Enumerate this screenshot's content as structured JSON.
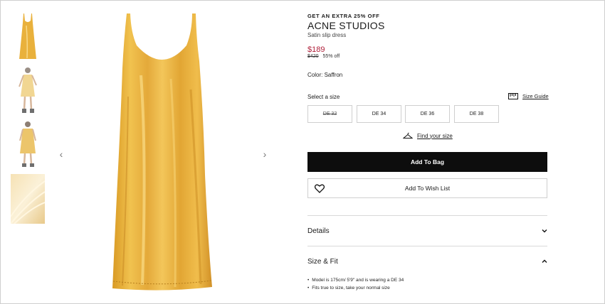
{
  "gallery": {
    "thumbnails": [
      "dress-front",
      "model-front",
      "model-back",
      "fabric-detail"
    ],
    "prev_icon": "‹",
    "next_icon": "›"
  },
  "product": {
    "promo": "GET AN EXTRA 25% OFF",
    "brand": "ACNE STUDIOS",
    "name": "Satin slip dress",
    "price_now": "$189",
    "price_was": "$420",
    "discount": "55% off",
    "color_label": "Color: Saffron",
    "colors": {
      "dress": "#e9b13c",
      "price_red": "#b0203a"
    }
  },
  "sizes": {
    "label": "Select a size",
    "guide_label": "Size Guide",
    "options": [
      {
        "label": "DE 32",
        "available": false
      },
      {
        "label": "DE 34",
        "available": true
      },
      {
        "label": "DE 36",
        "available": true
      },
      {
        "label": "DE 38",
        "available": true
      }
    ],
    "find_label": "Find your size"
  },
  "actions": {
    "add_to_bag": "Add To Bag",
    "wish_list": "Add To Wish List"
  },
  "accordion": {
    "details": "Details",
    "size_fit": "Size & Fit",
    "size_fit_items": [
      "Model is 175cm/ 5'9\" and is wearing a DE 34",
      "Fits true to size, take your normal size"
    ]
  }
}
